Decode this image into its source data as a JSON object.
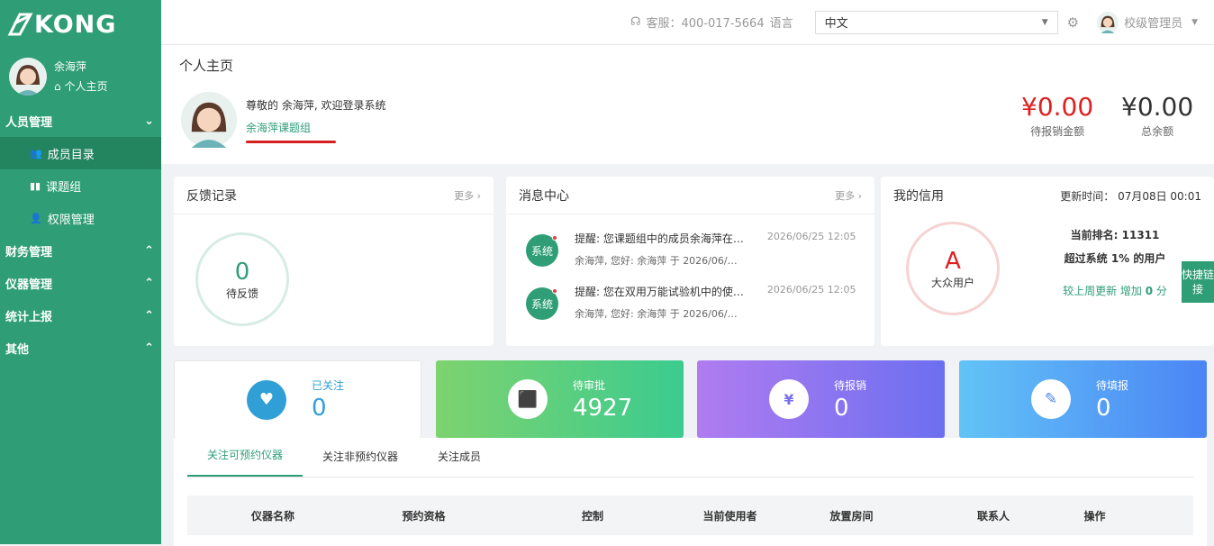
{
  "brand": {
    "logo_text": "KONG"
  },
  "user": {
    "name": "余海萍",
    "home_link": "个人主页"
  },
  "sidebar": {
    "groups": [
      {
        "label": "人员管理",
        "items": [
          {
            "label": "成员目录",
            "icon": "users-icon"
          },
          {
            "label": "课题组",
            "icon": "book-icon"
          },
          {
            "label": "权限管理",
            "icon": "user-key-icon"
          }
        ]
      },
      {
        "label": "财务管理"
      },
      {
        "label": "仪器管理"
      },
      {
        "label": "统计上报"
      },
      {
        "label": "其他"
      }
    ]
  },
  "topbar": {
    "service": "客服：400-017-5664",
    "language_label": "语言",
    "language_value": "中文",
    "admin_label": "校级管理员"
  },
  "page": {
    "title": "个人主页"
  },
  "welcome": {
    "greeting": "尊敬的 余海萍, 欢迎登录系统",
    "group": "余海萍课题组"
  },
  "finance": {
    "pending_amount": "¥0.00",
    "pending_label": "待报销金额",
    "total_amount": "¥0.00",
    "total_label": "总余额"
  },
  "feedback": {
    "title": "反馈记录",
    "more": "更多",
    "count": "0",
    "label": "待反馈"
  },
  "messages": {
    "title": "消息中心",
    "more": "更多",
    "items": [
      {
        "badge": "系统",
        "title": "提醒: 您课题组中的成员余海萍在…",
        "sub": "余海萍, 您好: 余海萍 于 2026/06/…",
        "time": "2026/06/25 12:05"
      },
      {
        "badge": "系统",
        "title": "提醒: 您在双用万能试验机中的使…",
        "sub": "余海萍, 您好: 余海萍 于 2026/06/…",
        "time": "2026/06/25 12:05"
      }
    ]
  },
  "credit": {
    "title": "我的信用",
    "update_label": "更新时间：",
    "update_time": "07月08日 00:01",
    "grade": "A",
    "grade_label": "大众用户",
    "rank_label": "当前排名:",
    "rank": "11311",
    "exceed_prefix": "超过系统",
    "exceed_pct": "1%",
    "exceed_suffix": "的用户",
    "weekly_prefix": "较上周更新 增加",
    "weekly_value": "0",
    "weekly_unit": "分"
  },
  "stats": [
    {
      "label": "已关注",
      "value": "0",
      "icon": "heart-icon",
      "colors": [
        "#ffffff",
        "#ffffff"
      ]
    },
    {
      "label": "待审批",
      "value": "4927",
      "icon": "stamp-icon",
      "colors": [
        "#7dd36f",
        "#3ccb8f"
      ]
    },
    {
      "label": "待报销",
      "value": "0",
      "icon": "invoice-icon",
      "colors": [
        "#b07cf0",
        "#6c6ff0"
      ]
    },
    {
      "label": "待填报",
      "value": "0",
      "icon": "edit-icon",
      "colors": [
        "#62c3f6",
        "#4b85f5"
      ]
    }
  ],
  "tabs": [
    "关注可预约仪器",
    "关注非预约仪器",
    "关注成员"
  ],
  "table": {
    "columns": [
      "仪器名称",
      "预约资格",
      "控制",
      "当前使用者",
      "放置房间",
      "联系人",
      "操作"
    ]
  },
  "quick_link": "快捷链接",
  "colors": {
    "brand_green": "#2f9e77",
    "red_amount": "#e02020"
  }
}
